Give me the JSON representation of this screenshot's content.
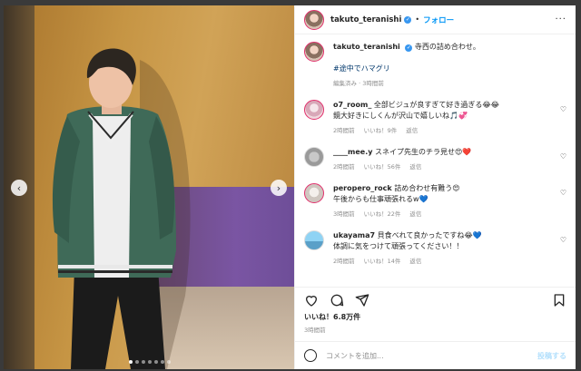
{
  "post": {
    "username": "takuto_teranishi",
    "follow_label": "フォロー",
    "separator": "•",
    "caption": "寺西の詰め合わせ。",
    "hashtag": "#途中でハマグリ",
    "caption_meta": "編集済み · 3時間前"
  },
  "comments": [
    {
      "username": "o7_room_",
      "text1": "全部ビジュが良すぎて好き過ぎる😂😂",
      "text2": "鏡大好きにしくんが沢山で嬉しいね🎵💞",
      "time": "2時間前",
      "likes": "いいね！9件",
      "reply": "返信"
    },
    {
      "username": "____mee.y",
      "text1": "スネイプ先生のチラ見せ😍❤️",
      "text2": "",
      "time": "2時間前",
      "likes": "いいね！56件",
      "reply": "返信"
    },
    {
      "username": "peropero_rock",
      "text1": "詰め合わせ有難う😍",
      "text2": "午後からも仕事頑張れるw💙",
      "time": "3時間前",
      "likes": "いいね！22件",
      "reply": "返信"
    },
    {
      "username": "ukayama7",
      "text1": "貝食べれて良かったですね😂💙",
      "text2": "体調に気をつけて頑張ってください！！",
      "time": "2時間前",
      "likes": "いいね！14件",
      "reply": "返信"
    }
  ],
  "stats": {
    "likes": "いいね！6.8万件",
    "time": "3時間前"
  },
  "add_comment": {
    "placeholder": "コメントを追加...",
    "post_label": "投稿する"
  },
  "icons": {
    "heart": "heart-icon",
    "comment": "comment-icon",
    "share": "share-icon",
    "save": "bookmark-icon",
    "emoji": "emoji-icon",
    "prev": "chevron-left-icon",
    "next": "chevron-right-icon"
  },
  "colors": {
    "link": "#0095f6",
    "hashtag": "#00376b",
    "muted": "#8e8e8e",
    "text": "#262626"
  }
}
